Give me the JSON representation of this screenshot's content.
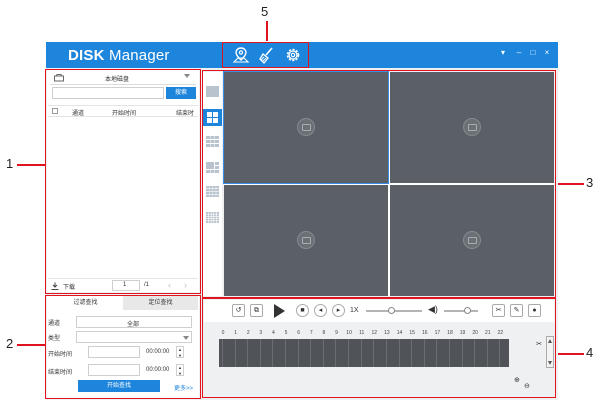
{
  "callouts": {
    "c1": "1",
    "c2": "2",
    "c3": "3",
    "c4": "4",
    "c5": "5"
  },
  "app": {
    "title_bold": "DISK",
    "title_rest": " Manager"
  },
  "title_icons": [
    "map-marker-icon",
    "broom-icon",
    "gear-icon"
  ],
  "window_controls": [
    "▾",
    "–",
    "□",
    "×"
  ],
  "left_panel": {
    "drive_select": "本地磁盘",
    "search_button": "搜索",
    "table_columns": [
      "通道",
      "开始时间",
      "结束时间"
    ],
    "download_label": "下载",
    "page_current": "1",
    "page_total": "/1"
  },
  "filter": {
    "tabs": [
      "过滤查找",
      "定位查找"
    ],
    "channel_label": "通道",
    "channel_value": "全部",
    "type_label": "类型",
    "start_label": "开始时间",
    "start_time": "00:00:00",
    "end_label": "结束时间",
    "end_time": "00:00:00",
    "start_button": "开始查找",
    "more_link": "更多>>"
  },
  "playback": {
    "speed": "1X"
  },
  "timeline": {
    "hours": [
      "0",
      "1",
      "2",
      "3",
      "4",
      "5",
      "6",
      "7",
      "8",
      "9",
      "10",
      "11",
      "12",
      "13",
      "14",
      "15",
      "16",
      "17",
      "18",
      "19",
      "20",
      "21",
      "22"
    ]
  },
  "colors": {
    "accent": "#1e85dc",
    "callout_red": "#e0141e",
    "video_cell": "#5b6067"
  }
}
